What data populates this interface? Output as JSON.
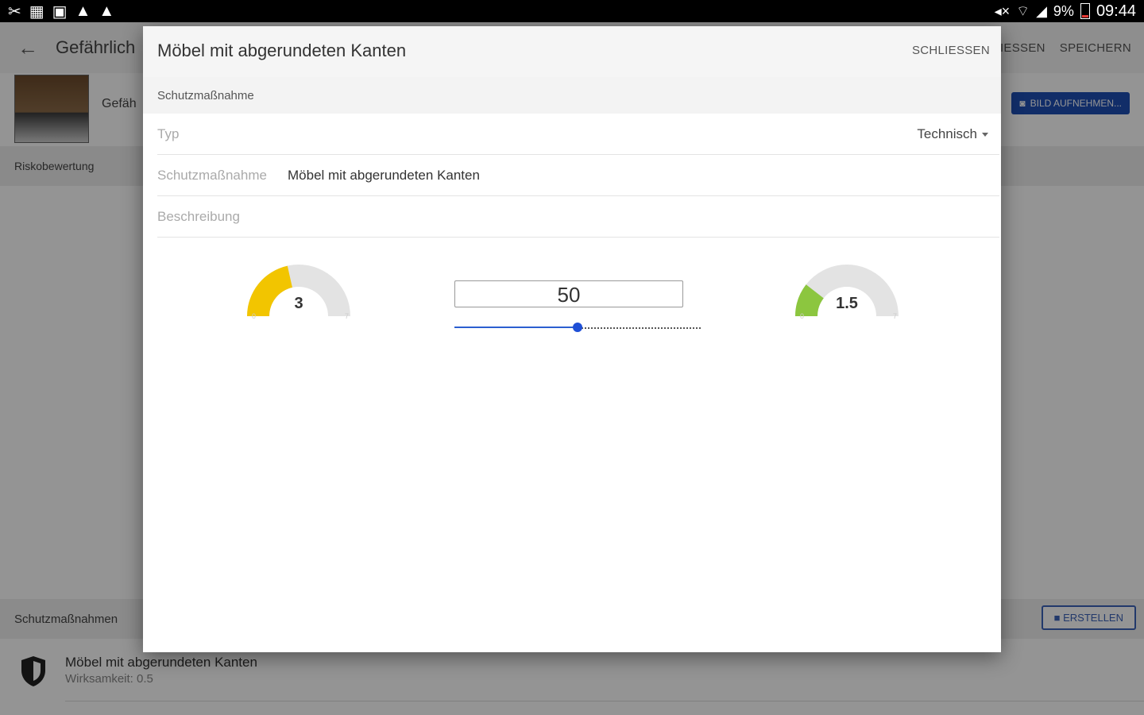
{
  "status_bar": {
    "notification_icons": [
      "tools-icon",
      "notes-icon",
      "gallery-icon",
      "warning-icon",
      "warning-icon"
    ],
    "battery": "9%",
    "time": "09:44"
  },
  "appbar": {
    "title": "Gefährlich",
    "actions": [
      "LIESSEN",
      "SPEICHERN"
    ]
  },
  "hazard": {
    "label": "Gefäh",
    "photo_button": "BILD AUFNEHMEN..."
  },
  "risk_section": {
    "label": "Riskobewertung"
  },
  "measures_section": {
    "label": "Schutzmaßnahmen",
    "create_button": "ERSTELLEN"
  },
  "measure_item": {
    "title": "Möbel mit abgerundeten Kanten",
    "subtitle": "Wirksamkeit: 0.5"
  },
  "dialog": {
    "title": "Möbel mit abgerundeten Kanten",
    "close_button": "SCHLIESSEN",
    "section_label": "Schutzmaßnahme",
    "fields": {
      "type": {
        "label": "Typ",
        "value": "Technisch"
      },
      "measure": {
        "label": "Schutzmaßnahme",
        "value": "Möbel mit abgerundeten Kanten"
      },
      "description": {
        "label": "Beschreibung"
      }
    },
    "gauge_left": {
      "value": "3",
      "min": "0",
      "max": "7",
      "fraction": 0.43,
      "color": "#f2c500"
    },
    "slider": {
      "value": "50",
      "percent": 50
    },
    "gauge_right": {
      "value": "1.5",
      "min": "0",
      "max": "7",
      "fraction": 0.21,
      "color": "#8cc63f"
    }
  }
}
